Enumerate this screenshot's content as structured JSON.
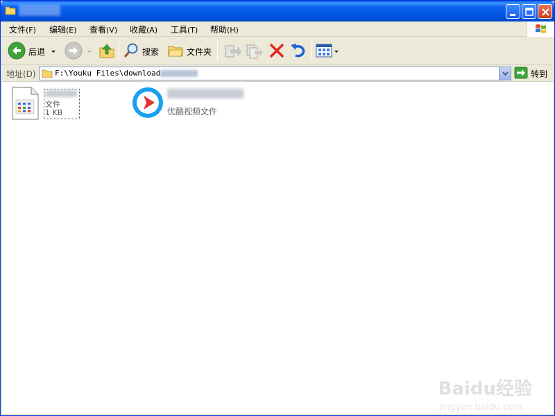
{
  "menu": {
    "items": [
      {
        "label": "文件",
        "hotkey": "(F)"
      },
      {
        "label": "编辑",
        "hotkey": "(E)"
      },
      {
        "label": "查看",
        "hotkey": "(V)"
      },
      {
        "label": "收藏",
        "hotkey": "(A)"
      },
      {
        "label": "工具",
        "hotkey": "(T)"
      },
      {
        "label": "帮助",
        "hotkey": "(H)"
      }
    ]
  },
  "toolbar": {
    "back_label": "后退",
    "search_label": "搜索",
    "folders_label": "文件夹"
  },
  "address": {
    "label": "地址(D)",
    "path": "F:\\Youku Files\\download",
    "go_label": "转到"
  },
  "files": [
    {
      "type_label": "文件",
      "size_label": "1 KB",
      "icon": "generic-file-icon"
    },
    {
      "type_label": "优酷视频文件",
      "icon": "youku-video-icon"
    }
  ],
  "watermark": {
    "main": "Baidu经验",
    "sub": "jingyan.baidu.com"
  },
  "colors": {
    "titlebar": "#0054e3",
    "window_bg": "#ece9d8",
    "youku_red": "#e4322b",
    "youku_blue": "#1aa0f0"
  }
}
